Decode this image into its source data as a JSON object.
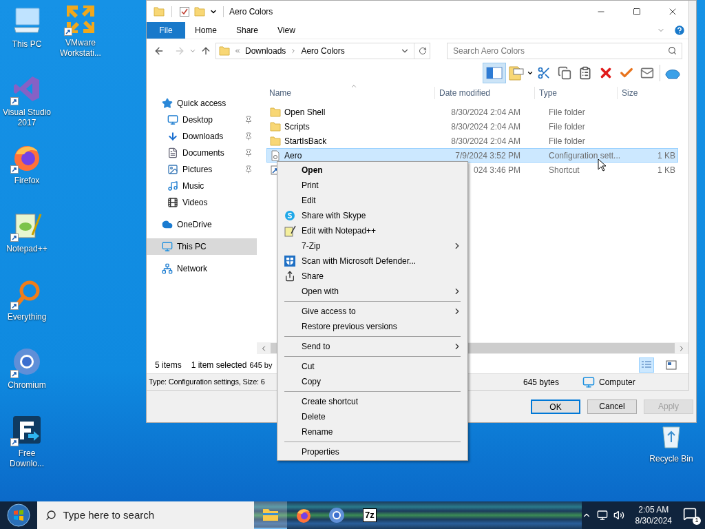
{
  "desktop": {
    "column_1": [
      {
        "label": "This PC",
        "kind": "pc",
        "shortcut": false
      },
      {
        "label": "Visual Studio 2017",
        "kind": "vs",
        "shortcut": true
      },
      {
        "label": "Firefox",
        "kind": "firefox",
        "shortcut": true
      },
      {
        "label": "Notepad++",
        "kind": "notepad",
        "shortcut": true
      },
      {
        "label": "Everything",
        "kind": "everything",
        "shortcut": true
      },
      {
        "label": "Chromium",
        "kind": "chromium",
        "shortcut": true
      },
      {
        "label": "Free Downlo...",
        "kind": "fdm",
        "shortcut": true
      }
    ],
    "column_2": [
      {
        "label": "VMware Workstati...",
        "kind": "vmware",
        "shortcut": true
      }
    ],
    "corner": [
      {
        "label": "Recycle Bin",
        "kind": "recycle",
        "shortcut": false
      }
    ]
  },
  "window": {
    "title": "Aero Colors",
    "ribbon_tabs": [
      {
        "label": "File",
        "kind": "file",
        "selected": false
      },
      {
        "label": "Home",
        "kind": "tab",
        "selected": false
      },
      {
        "label": "Share",
        "kind": "tab",
        "selected": false
      },
      {
        "label": "View",
        "kind": "tab",
        "selected": false
      }
    ],
    "address": [
      "Downloads",
      "Aero Colors"
    ],
    "search": {
      "placeholder": "Search Aero Colors"
    },
    "preview_pane_on": true,
    "navigation": [
      {
        "label": "Quick access",
        "kind": "star",
        "selected": false,
        "children": [
          {
            "label": "Desktop",
            "kind": "desktop",
            "pinned": true,
            "selected": false
          },
          {
            "label": "Downloads",
            "kind": "download",
            "pinned": true,
            "selected": false
          },
          {
            "label": "Documents",
            "kind": "document",
            "pinned": true,
            "selected": false
          },
          {
            "label": "Pictures",
            "kind": "picture",
            "pinned": true,
            "selected": false
          },
          {
            "label": "Music",
            "kind": "music",
            "pinned": false,
            "selected": false
          },
          {
            "label": "Videos",
            "kind": "video",
            "pinned": false,
            "selected": false
          }
        ]
      },
      {
        "label": "OneDrive",
        "kind": "cloud",
        "selected": false
      },
      {
        "label": "This PC",
        "kind": "pc",
        "selected": true
      },
      {
        "label": "Network",
        "kind": "network",
        "selected": false
      }
    ],
    "columns": [
      "Name",
      "Date modified",
      "Type",
      "Size"
    ],
    "rows": [
      {
        "name": "Open Shell",
        "kind": "folder",
        "date": "8/30/2024 2:04 AM",
        "type": "File folder",
        "selected": false
      },
      {
        "name": "Scripts",
        "kind": "folder",
        "date": "8/30/2024 2:04 AM",
        "type": "File folder",
        "selected": false
      },
      {
        "name": "StartIsBack",
        "kind": "folder",
        "date": "8/30/2024 2:04 AM",
        "type": "File folder",
        "selected": false
      },
      {
        "name": "Aero",
        "kind": "config",
        "date": "7/9/2024 3:52 PM",
        "type": "Configuration sett...",
        "size": "1 KB",
        "selected": true
      },
      {
        "kind": "shortcut",
        "date": "024 3:46 PM",
        "type": "Shortcut",
        "size": "1 KB",
        "selected": false
      }
    ],
    "status": {
      "count": "5 items",
      "selection": "1 item selected",
      "size": "645 by"
    },
    "view_buttons": [
      {
        "kind": "details",
        "selected": true
      },
      {
        "kind": "tiles",
        "selected": false
      }
    ],
    "details_bar": {
      "info": "Type: Configuration settings, Size: 6",
      "size": "645 bytes",
      "zone": "Computer"
    },
    "buttons": [
      {
        "label": "OK",
        "default": true,
        "disabled": false
      },
      {
        "label": "Cancel",
        "default": false,
        "disabled": false
      },
      {
        "label": "Apply",
        "default": false,
        "disabled": true
      }
    ]
  },
  "context_menu": [
    {
      "kind": "item",
      "label": "Open",
      "bold": true,
      "submenu": false
    },
    {
      "kind": "item",
      "label": "Print",
      "bold": false,
      "submenu": false
    },
    {
      "kind": "item",
      "label": "Edit",
      "bold": false,
      "submenu": false
    },
    {
      "kind": "skype",
      "label": "Share with Skype",
      "bold": false,
      "submenu": false
    },
    {
      "kind": "notepad",
      "label": "Edit with Notepad++",
      "bold": false,
      "submenu": false
    },
    {
      "kind": "item",
      "label": "7-Zip",
      "bold": false,
      "submenu": true
    },
    {
      "kind": "defender",
      "label": "Scan with Microsoft Defender...",
      "bold": false,
      "submenu": false
    },
    {
      "kind": "share",
      "label": "Share",
      "bold": false,
      "submenu": false
    },
    {
      "kind": "item",
      "label": "Open with",
      "bold": false,
      "submenu": true
    },
    {
      "kind": "separator"
    },
    {
      "kind": "item",
      "label": "Give access to",
      "bold": false,
      "submenu": true
    },
    {
      "kind": "item",
      "label": "Restore previous versions",
      "bold": false,
      "submenu": false
    },
    {
      "kind": "separator"
    },
    {
      "kind": "item",
      "label": "Send to",
      "bold": false,
      "submenu": true
    },
    {
      "kind": "separator"
    },
    {
      "kind": "item",
      "label": "Cut",
      "bold": false,
      "submenu": false
    },
    {
      "kind": "item",
      "label": "Copy",
      "bold": false,
      "submenu": false
    },
    {
      "kind": "separator"
    },
    {
      "kind": "item",
      "label": "Create shortcut",
      "bold": false,
      "submenu": false
    },
    {
      "kind": "item",
      "label": "Delete",
      "bold": false,
      "submenu": false
    },
    {
      "kind": "item",
      "label": "Rename",
      "bold": false,
      "submenu": false
    },
    {
      "kind": "separator"
    },
    {
      "kind": "item",
      "label": "Properties",
      "bold": false,
      "submenu": false
    }
  ],
  "taskbar": {
    "search_placeholder": "Type here to search",
    "apps": [
      {
        "kind": "explorer",
        "active": true
      },
      {
        "kind": "firefox",
        "active": false
      },
      {
        "kind": "chromium",
        "active": false
      },
      {
        "kind": "sevenzip",
        "label": "7z",
        "active": false
      }
    ],
    "time": "2:05 AM",
    "date": "8/30/2024",
    "notifications": "1"
  }
}
